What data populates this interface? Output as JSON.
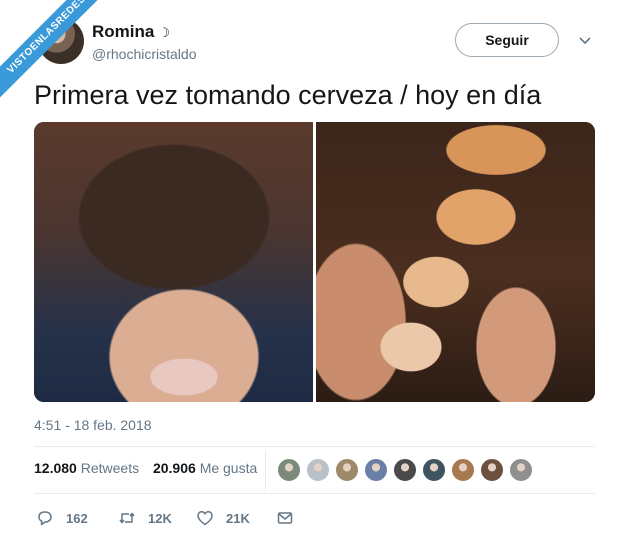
{
  "watermark": {
    "text": "VISTOENLASREDES",
    "color": "#3a9ad9"
  },
  "user": {
    "display_name": "Romina",
    "name_emoji": "☽",
    "handle": "@rhochicristaldo"
  },
  "follow": {
    "label": "Seguir"
  },
  "tweet": {
    "text": "Primera vez tomando cerveza / hoy en día"
  },
  "meta": {
    "timestamp": "4:51 - 18 feb. 2018"
  },
  "stats": {
    "retweets_count": "12.080",
    "retweets_label": "Retweets",
    "likes_count": "20.906",
    "likes_label": "Me gusta"
  },
  "likers": [
    "#7b8a7a",
    "#b8c0c8",
    "#9c8a6a",
    "#6a7fa6",
    "#4a4a4a",
    "#3e5560",
    "#a8784e",
    "#6e5040",
    "#8f8f8f"
  ],
  "actions": {
    "replies": "162",
    "retweets": "12K",
    "likes": "21K"
  },
  "colors": {
    "text_primary": "#14171a",
    "text_secondary": "#657786",
    "border": "#e6ecf0"
  }
}
